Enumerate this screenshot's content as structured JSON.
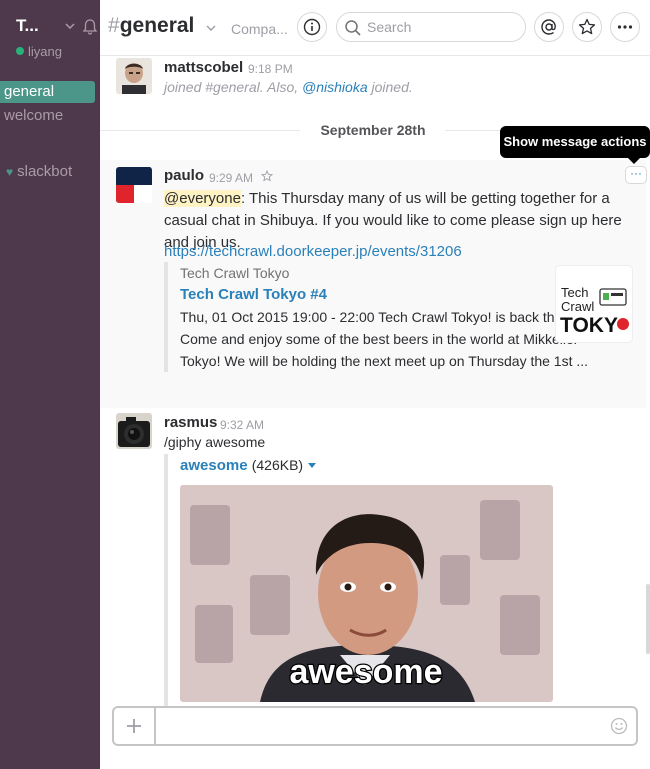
{
  "sidebar": {
    "team_name": "T...",
    "user_name": "liyang",
    "channels": [
      {
        "label": "general",
        "active": true
      },
      {
        "label": "welcome",
        "active": false
      }
    ],
    "dms": [
      {
        "label": "slackbot"
      }
    ]
  },
  "header": {
    "hash": "#",
    "channel_name": "general",
    "topic": "Compa...",
    "search_placeholder": "Search"
  },
  "messages": {
    "m1": {
      "author": "mattscobel",
      "time": "9:18 PM",
      "text_a": "joined #general. Also, ",
      "mention": "@nishioka",
      "text_b": " joined."
    },
    "day_divider": "September 28th",
    "m2": {
      "author": "paulo",
      "time": "9:29 AM",
      "everyone": "@everyone",
      "text": ": This Thursday many of us will be getting together for a casual chat in Shibuya. If you would like to come please sign up here and join us.",
      "url": "https://techcrawl.doorkeeper.jp/events/31206",
      "attachment": {
        "service": "Tech Crawl Tokyo",
        "title": "Tech Crawl Tokyo #4",
        "text": "Thu, 01 Oct 2015 19:00 - 22:00 Tech Crawl Tokyo! is back this month! Come and enjoy some of the best beers in the world at Mikkeller Tokyo! We will be holding the next meet up on Thursday the 1st ...",
        "thumb_line1": "Tech",
        "thumb_line2": "Crawl",
        "thumb_line3": "TOKY"
      }
    },
    "m3": {
      "author": "rasmus",
      "time": "9:32 AM",
      "text": "/giphy awesome",
      "file_name": "awesome",
      "file_size": "(426KB)",
      "gif_caption": "awesome"
    }
  },
  "tooltip": "Show message actions",
  "actions_glyph": "···",
  "colors": {
    "sidebar_bg": "#4d394b",
    "active_channel": "#4c9689",
    "link": "#2a80b9",
    "presence": "#2ab27b",
    "everyone_highlight": "#fff3c4"
  },
  "icons": [
    "bell-icon",
    "chevron-down-icon",
    "info-icon",
    "search-icon",
    "at-icon",
    "star-icon",
    "more-icon",
    "plus-icon",
    "emoji-icon",
    "heart-icon"
  ]
}
